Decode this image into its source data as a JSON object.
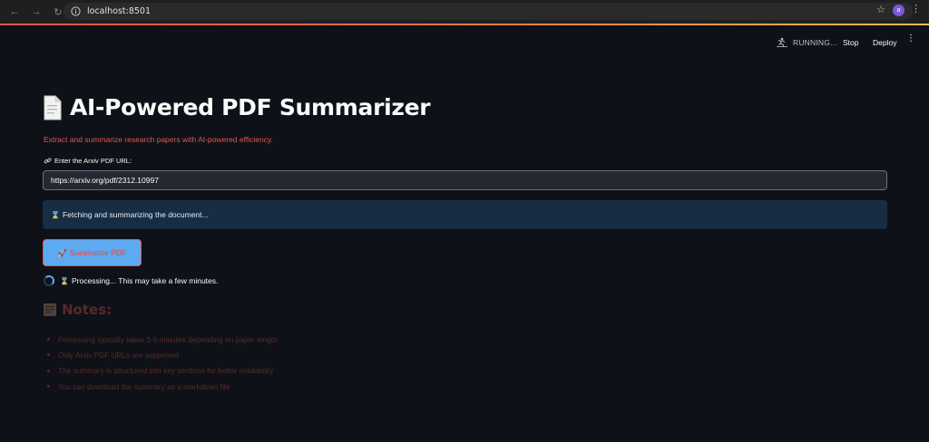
{
  "browser": {
    "url": "localhost:8501",
    "avatar_letter": "a"
  },
  "app_header": {
    "status": "RUNNING...",
    "stop_label": "Stop",
    "deploy_label": "Deploy"
  },
  "main": {
    "title": "AI-Powered PDF Summarizer",
    "subtitle": "Extract and summarize research papers with AI-powered efficiency.",
    "input_label": "Enter the Arxiv PDF URL:",
    "input_value": "https://arxiv.org/pdf/2312.10997",
    "info_message": "Fetching and summarizing the document...",
    "button_label": "Summarize PDF",
    "processing_text": "Processing... This may take a few minutes.",
    "notes_title": "Notes:",
    "notes": [
      "Processing typically takes 3-5 minutes depending on paper length",
      "Only Arxiv PDF URLs are supported",
      "The summary is structured into key sections for better readability",
      "You can download the summary as a markdown file"
    ]
  },
  "colors": {
    "background": "#0e1117",
    "accent_red": "#e0584f",
    "info_bg": "#172d43",
    "button_bg": "#5eaaf0"
  }
}
